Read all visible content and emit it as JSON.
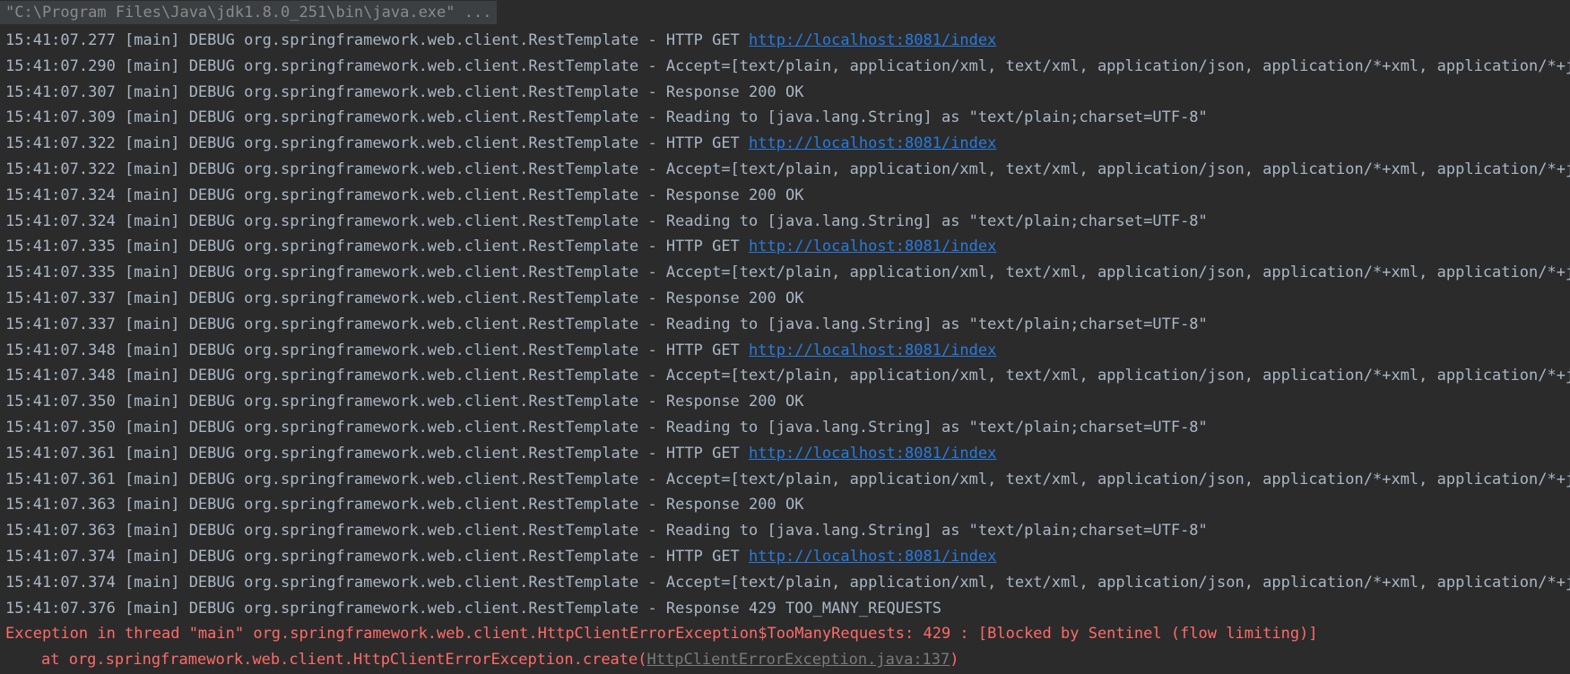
{
  "console": {
    "command": "\"C:\\Program Files\\Java\\jdk1.8.0_251\\bin\\java.exe\" ...",
    "lines": [
      {
        "prefix": "15:41:07.277 [main] DEBUG org.springframework.web.client.RestTemplate - HTTP GET ",
        "link": "http://localhost:8081/index"
      },
      {
        "prefix": "15:41:07.290 [main] DEBUG org.springframework.web.client.RestTemplate - Accept=[text/plain, application/xml, text/xml, application/json, application/*+xml, application/*+json, */*]",
        "link": ""
      },
      {
        "prefix": "15:41:07.307 [main] DEBUG org.springframework.web.client.RestTemplate - Response 200 OK",
        "link": ""
      },
      {
        "prefix": "15:41:07.309 [main] DEBUG org.springframework.web.client.RestTemplate - Reading to [java.lang.String] as \"text/plain;charset=UTF-8\"",
        "link": ""
      },
      {
        "prefix": "15:41:07.322 [main] DEBUG org.springframework.web.client.RestTemplate - HTTP GET ",
        "link": "http://localhost:8081/index"
      },
      {
        "prefix": "15:41:07.322 [main] DEBUG org.springframework.web.client.RestTemplate - Accept=[text/plain, application/xml, text/xml, application/json, application/*+xml, application/*+json, */*]",
        "link": ""
      },
      {
        "prefix": "15:41:07.324 [main] DEBUG org.springframework.web.client.RestTemplate - Response 200 OK",
        "link": ""
      },
      {
        "prefix": "15:41:07.324 [main] DEBUG org.springframework.web.client.RestTemplate - Reading to [java.lang.String] as \"text/plain;charset=UTF-8\"",
        "link": ""
      },
      {
        "prefix": "15:41:07.335 [main] DEBUG org.springframework.web.client.RestTemplate - HTTP GET ",
        "link": "http://localhost:8081/index"
      },
      {
        "prefix": "15:41:07.335 [main] DEBUG org.springframework.web.client.RestTemplate - Accept=[text/plain, application/xml, text/xml, application/json, application/*+xml, application/*+json, */*]",
        "link": ""
      },
      {
        "prefix": "15:41:07.337 [main] DEBUG org.springframework.web.client.RestTemplate - Response 200 OK",
        "link": ""
      },
      {
        "prefix": "15:41:07.337 [main] DEBUG org.springframework.web.client.RestTemplate - Reading to [java.lang.String] as \"text/plain;charset=UTF-8\"",
        "link": ""
      },
      {
        "prefix": "15:41:07.348 [main] DEBUG org.springframework.web.client.RestTemplate - HTTP GET ",
        "link": "http://localhost:8081/index"
      },
      {
        "prefix": "15:41:07.348 [main] DEBUG org.springframework.web.client.RestTemplate - Accept=[text/plain, application/xml, text/xml, application/json, application/*+xml, application/*+json, */*]",
        "link": ""
      },
      {
        "prefix": "15:41:07.350 [main] DEBUG org.springframework.web.client.RestTemplate - Response 200 OK",
        "link": ""
      },
      {
        "prefix": "15:41:07.350 [main] DEBUG org.springframework.web.client.RestTemplate - Reading to [java.lang.String] as \"text/plain;charset=UTF-8\"",
        "link": ""
      },
      {
        "prefix": "15:41:07.361 [main] DEBUG org.springframework.web.client.RestTemplate - HTTP GET ",
        "link": "http://localhost:8081/index"
      },
      {
        "prefix": "15:41:07.361 [main] DEBUG org.springframework.web.client.RestTemplate - Accept=[text/plain, application/xml, text/xml, application/json, application/*+xml, application/*+json, */*]",
        "link": ""
      },
      {
        "prefix": "15:41:07.363 [main] DEBUG org.springframework.web.client.RestTemplate - Response 200 OK",
        "link": ""
      },
      {
        "prefix": "15:41:07.363 [main] DEBUG org.springframework.web.client.RestTemplate - Reading to [java.lang.String] as \"text/plain;charset=UTF-8\"",
        "link": ""
      },
      {
        "prefix": "15:41:07.374 [main] DEBUG org.springframework.web.client.RestTemplate - HTTP GET ",
        "link": "http://localhost:8081/index"
      },
      {
        "prefix": "15:41:07.374 [main] DEBUG org.springframework.web.client.RestTemplate - Accept=[text/plain, application/xml, text/xml, application/json, application/*+xml, application/*+json, */*]",
        "link": ""
      },
      {
        "prefix": "15:41:07.376 [main] DEBUG org.springframework.web.client.RestTemplate - Response 429 TOO_MANY_REQUESTS",
        "link": ""
      }
    ],
    "error": {
      "message": "Exception in thread \"main\" org.springframework.web.client.HttpClientErrorException$TooManyRequests: 429 : [Blocked by Sentinel (flow limiting)]",
      "trace_prefix": "at org.springframework.web.client.HttpClientErrorException.create(",
      "trace_link": "HttpClientErrorException.java:137",
      "trace_suffix": ")"
    }
  },
  "colors": {
    "background": "#2b2b2b",
    "text": "#a9b7c6",
    "link": "#287bde",
    "error": "#ff6b68"
  }
}
